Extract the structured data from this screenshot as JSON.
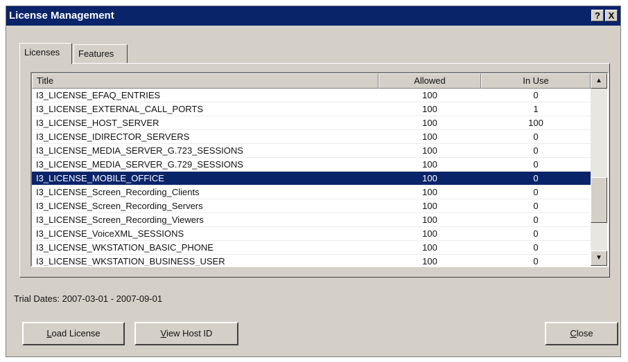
{
  "window": {
    "title": "License Management",
    "help_button": "?",
    "close_button": "X"
  },
  "tabs": [
    {
      "label": "Licenses",
      "active": true
    },
    {
      "label": "Features",
      "active": false
    }
  ],
  "table": {
    "columns": [
      "Title",
      "Allowed",
      "In Use"
    ],
    "rows": [
      {
        "title": "I3_LICENSE_EFAQ_ENTRIES",
        "allowed": "100",
        "in_use": "0"
      },
      {
        "title": "I3_LICENSE_EXTERNAL_CALL_PORTS",
        "allowed": "100",
        "in_use": "1"
      },
      {
        "title": "I3_LICENSE_HOST_SERVER",
        "allowed": "100",
        "in_use": "100"
      },
      {
        "title": "I3_LICENSE_IDIRECTOR_SERVERS",
        "allowed": "100",
        "in_use": "0"
      },
      {
        "title": "I3_LICENSE_MEDIA_SERVER_G.723_SESSIONS",
        "allowed": "100",
        "in_use": "0"
      },
      {
        "title": "I3_LICENSE_MEDIA_SERVER_G.729_SESSIONS",
        "allowed": "100",
        "in_use": "0"
      },
      {
        "title": "I3_LICENSE_MOBILE_OFFICE",
        "allowed": "100",
        "in_use": "0",
        "selected": true
      },
      {
        "title": "I3_LICENSE_Screen_Recording_Clients",
        "allowed": "100",
        "in_use": "0"
      },
      {
        "title": "I3_LICENSE_Screen_Recording_Servers",
        "allowed": "100",
        "in_use": "0"
      },
      {
        "title": "I3_LICENSE_Screen_Recording_Viewers",
        "allowed": "100",
        "in_use": "0"
      },
      {
        "title": "I3_LICENSE_VoiceXML_SESSIONS",
        "allowed": "100",
        "in_use": "0"
      },
      {
        "title": "I3_LICENSE_WKSTATION_BASIC_PHONE",
        "allowed": "100",
        "in_use": "0"
      },
      {
        "title": "I3_LICENSE_WKSTATION_BUSINESS_USER",
        "allowed": "100",
        "in_use": "0"
      }
    ]
  },
  "trial_dates": "Trial Dates: 2007-03-01 - 2007-09-01",
  "buttons": {
    "load_license": {
      "mnemonic": "L",
      "rest": "oad License"
    },
    "view_host_id": {
      "mnemonic": "V",
      "rest": "iew Host ID"
    },
    "close": {
      "mnemonic": "C",
      "rest": "lose"
    }
  },
  "colors": {
    "titlebar": "#0a246a",
    "selection": "#0a246a",
    "face": "#d4d0c8"
  }
}
